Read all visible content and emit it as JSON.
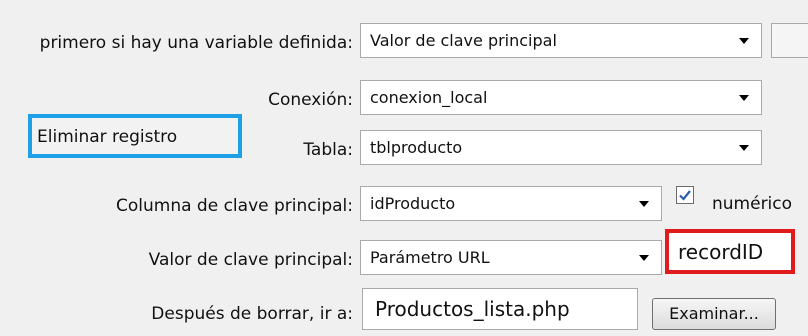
{
  "form": {
    "first_label": "primero si hay una variable definida:",
    "first_value": "Valor de clave principal",
    "connection_label": "Conexión:",
    "connection_value": "conexion_local",
    "table_label": "Tabla:",
    "table_value": "tblproducto",
    "pk_column_label": "Columna de clave principal:",
    "pk_column_value": "idProducto",
    "numeric_label": "numérico",
    "numeric_checked": true,
    "pk_value_label": "Valor de clave principal:",
    "pk_value_value": "Parámetro URL",
    "record_id": "recordID",
    "after_delete_label": "Después de borrar, ir a:",
    "after_delete_value": "Productos_lista.php",
    "browse_button": "Examinar..."
  },
  "callout": {
    "title": "Eliminar registro"
  },
  "colors": {
    "callout_border": "#1ea0e6",
    "highlight_border": "#e01b1b",
    "checkbox_check": "#2a5db0"
  }
}
